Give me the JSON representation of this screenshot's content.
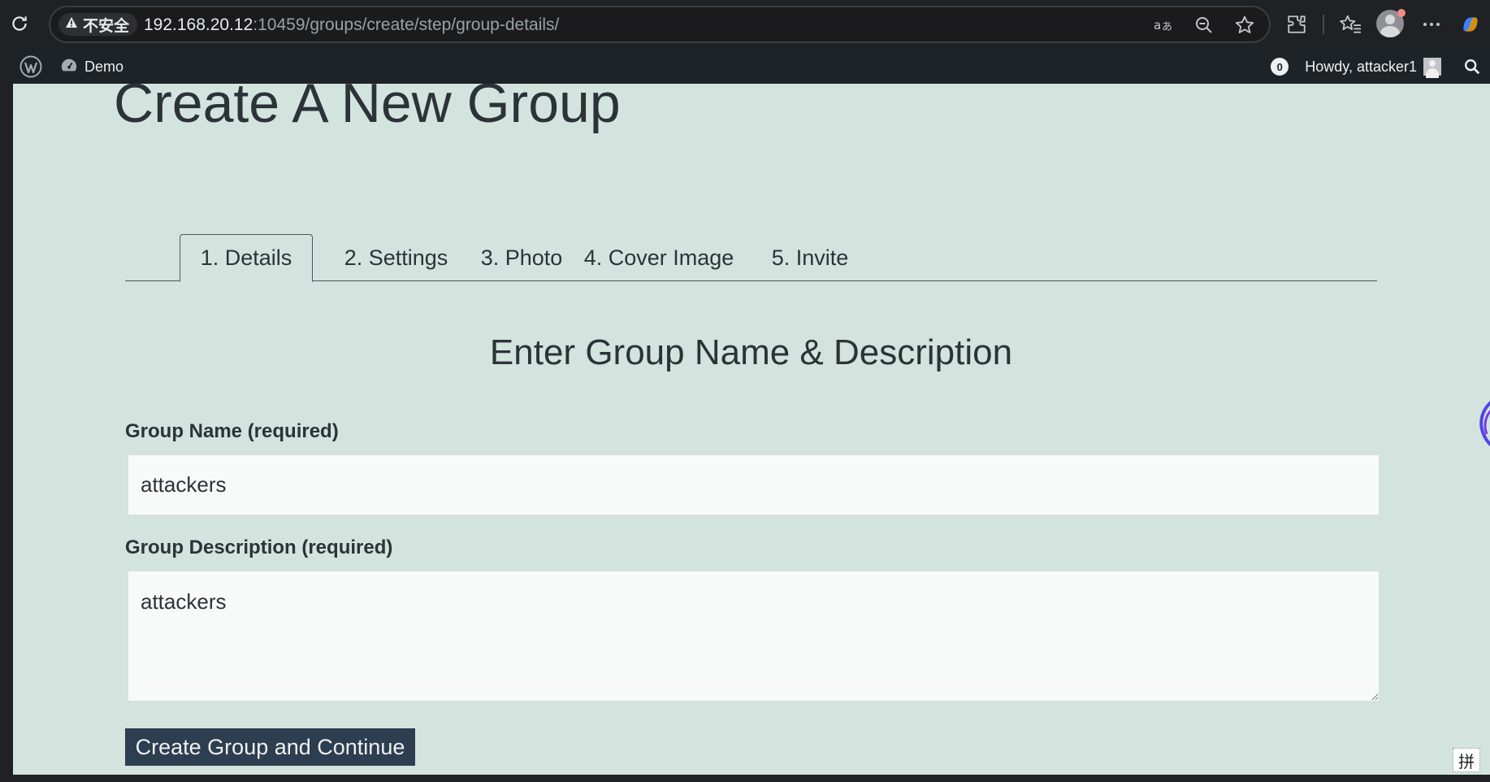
{
  "browser": {
    "security_label": "不安全",
    "url_host": "192.168.20.12",
    "url_rest": ":10459/groups/create/step/group-details/"
  },
  "admin_bar": {
    "site_name": "Demo",
    "notification_count": "0",
    "howdy": "Howdy, attacker1"
  },
  "page": {
    "title": "Create A New Group",
    "tabs": [
      {
        "label": "1. Details",
        "active": true
      },
      {
        "label": "2. Settings",
        "active": false
      },
      {
        "label": "3. Photo",
        "active": false
      },
      {
        "label": "4. Cover Image",
        "active": false
      },
      {
        "label": "5. Invite",
        "active": false
      }
    ],
    "section_heading": "Enter Group Name & Description",
    "group_name": {
      "label": "Group Name (required)",
      "value": "attackers"
    },
    "group_description": {
      "label": "Group Description (required)",
      "value": "attackers"
    },
    "submit_label": "Create Group and Continue"
  },
  "ime_indicator": "拼",
  "colors": {
    "page_background": "#d3e4df",
    "text": "#2c3338",
    "button": "#2c3e50",
    "admin_bar": "#1d2327",
    "browser_chrome": "#202124"
  }
}
